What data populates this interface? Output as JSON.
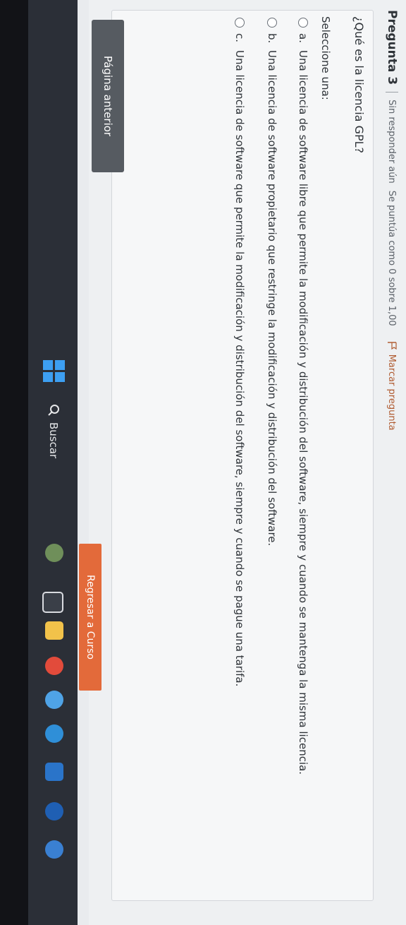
{
  "question": {
    "title": "Pregunta 3",
    "status": "Sin responder aún",
    "score": "Se puntúa como 0 sobre 1,00",
    "flag_label": "Marcar pregunta",
    "text": "¿Qué es la licencia GPL?",
    "prompt": "Seleccione una:",
    "answers": [
      {
        "letter": "a.",
        "text": "Una licencia de software libre que permite la modificación y distribución del software, siempre y cuando se mantenga la misma licencia."
      },
      {
        "letter": "b.",
        "text": "Una licencia de software propietario que restringe la modificación y distribución del software."
      },
      {
        "letter": "c.",
        "text": "Una licencia de software que permite la modificación y distribución del software, siempre y cuando se pague una tarifa."
      }
    ]
  },
  "nav": {
    "prev_label": "Página anterior",
    "back_label": "Regresar a Curso"
  },
  "taskbar": {
    "search_label": "Buscar",
    "icons": [
      "start-icon",
      "widgets-icon",
      "task-view-icon",
      "file-explorer-icon",
      "chrome-icon",
      "photos-icon",
      "edge-icon",
      "store-icon",
      "media-icon",
      "app-icon"
    ]
  },
  "colors": {
    "accent": "#e36a3a",
    "button": "#565b61",
    "taskbar": "#2b2f37"
  }
}
